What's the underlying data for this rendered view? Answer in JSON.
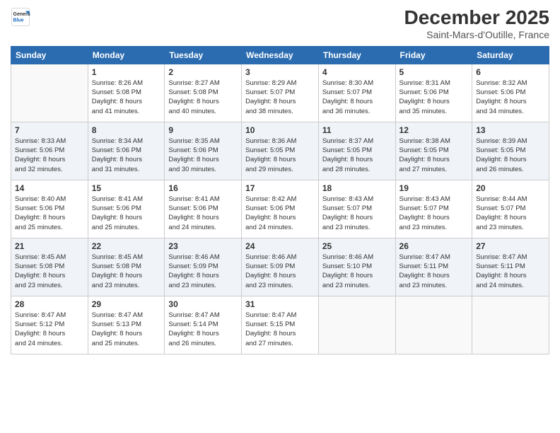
{
  "logo": {
    "line1": "General",
    "line2": "Blue"
  },
  "title": "December 2025",
  "location": "Saint-Mars-d'Outille, France",
  "header_days": [
    "Sunday",
    "Monday",
    "Tuesday",
    "Wednesday",
    "Thursday",
    "Friday",
    "Saturday"
  ],
  "weeks": [
    [
      {
        "day": "",
        "info": ""
      },
      {
        "day": "1",
        "info": "Sunrise: 8:26 AM\nSunset: 5:08 PM\nDaylight: 8 hours\nand 41 minutes."
      },
      {
        "day": "2",
        "info": "Sunrise: 8:27 AM\nSunset: 5:08 PM\nDaylight: 8 hours\nand 40 minutes."
      },
      {
        "day": "3",
        "info": "Sunrise: 8:29 AM\nSunset: 5:07 PM\nDaylight: 8 hours\nand 38 minutes."
      },
      {
        "day": "4",
        "info": "Sunrise: 8:30 AM\nSunset: 5:07 PM\nDaylight: 8 hours\nand 36 minutes."
      },
      {
        "day": "5",
        "info": "Sunrise: 8:31 AM\nSunset: 5:06 PM\nDaylight: 8 hours\nand 35 minutes."
      },
      {
        "day": "6",
        "info": "Sunrise: 8:32 AM\nSunset: 5:06 PM\nDaylight: 8 hours\nand 34 minutes."
      }
    ],
    [
      {
        "day": "7",
        "info": "Sunrise: 8:33 AM\nSunset: 5:06 PM\nDaylight: 8 hours\nand 32 minutes."
      },
      {
        "day": "8",
        "info": "Sunrise: 8:34 AM\nSunset: 5:06 PM\nDaylight: 8 hours\nand 31 minutes."
      },
      {
        "day": "9",
        "info": "Sunrise: 8:35 AM\nSunset: 5:06 PM\nDaylight: 8 hours\nand 30 minutes."
      },
      {
        "day": "10",
        "info": "Sunrise: 8:36 AM\nSunset: 5:05 PM\nDaylight: 8 hours\nand 29 minutes."
      },
      {
        "day": "11",
        "info": "Sunrise: 8:37 AM\nSunset: 5:05 PM\nDaylight: 8 hours\nand 28 minutes."
      },
      {
        "day": "12",
        "info": "Sunrise: 8:38 AM\nSunset: 5:05 PM\nDaylight: 8 hours\nand 27 minutes."
      },
      {
        "day": "13",
        "info": "Sunrise: 8:39 AM\nSunset: 5:05 PM\nDaylight: 8 hours\nand 26 minutes."
      }
    ],
    [
      {
        "day": "14",
        "info": "Sunrise: 8:40 AM\nSunset: 5:06 PM\nDaylight: 8 hours\nand 25 minutes."
      },
      {
        "day": "15",
        "info": "Sunrise: 8:41 AM\nSunset: 5:06 PM\nDaylight: 8 hours\nand 25 minutes."
      },
      {
        "day": "16",
        "info": "Sunrise: 8:41 AM\nSunset: 5:06 PM\nDaylight: 8 hours\nand 24 minutes."
      },
      {
        "day": "17",
        "info": "Sunrise: 8:42 AM\nSunset: 5:06 PM\nDaylight: 8 hours\nand 24 minutes."
      },
      {
        "day": "18",
        "info": "Sunrise: 8:43 AM\nSunset: 5:07 PM\nDaylight: 8 hours\nand 23 minutes."
      },
      {
        "day": "19",
        "info": "Sunrise: 8:43 AM\nSunset: 5:07 PM\nDaylight: 8 hours\nand 23 minutes."
      },
      {
        "day": "20",
        "info": "Sunrise: 8:44 AM\nSunset: 5:07 PM\nDaylight: 8 hours\nand 23 minutes."
      }
    ],
    [
      {
        "day": "21",
        "info": "Sunrise: 8:45 AM\nSunset: 5:08 PM\nDaylight: 8 hours\nand 23 minutes."
      },
      {
        "day": "22",
        "info": "Sunrise: 8:45 AM\nSunset: 5:08 PM\nDaylight: 8 hours\nand 23 minutes."
      },
      {
        "day": "23",
        "info": "Sunrise: 8:46 AM\nSunset: 5:09 PM\nDaylight: 8 hours\nand 23 minutes."
      },
      {
        "day": "24",
        "info": "Sunrise: 8:46 AM\nSunset: 5:09 PM\nDaylight: 8 hours\nand 23 minutes."
      },
      {
        "day": "25",
        "info": "Sunrise: 8:46 AM\nSunset: 5:10 PM\nDaylight: 8 hours\nand 23 minutes."
      },
      {
        "day": "26",
        "info": "Sunrise: 8:47 AM\nSunset: 5:11 PM\nDaylight: 8 hours\nand 23 minutes."
      },
      {
        "day": "27",
        "info": "Sunrise: 8:47 AM\nSunset: 5:11 PM\nDaylight: 8 hours\nand 24 minutes."
      }
    ],
    [
      {
        "day": "28",
        "info": "Sunrise: 8:47 AM\nSunset: 5:12 PM\nDaylight: 8 hours\nand 24 minutes."
      },
      {
        "day": "29",
        "info": "Sunrise: 8:47 AM\nSunset: 5:13 PM\nDaylight: 8 hours\nand 25 minutes."
      },
      {
        "day": "30",
        "info": "Sunrise: 8:47 AM\nSunset: 5:14 PM\nDaylight: 8 hours\nand 26 minutes."
      },
      {
        "day": "31",
        "info": "Sunrise: 8:47 AM\nSunset: 5:15 PM\nDaylight: 8 hours\nand 27 minutes."
      },
      {
        "day": "",
        "info": ""
      },
      {
        "day": "",
        "info": ""
      },
      {
        "day": "",
        "info": ""
      }
    ]
  ]
}
